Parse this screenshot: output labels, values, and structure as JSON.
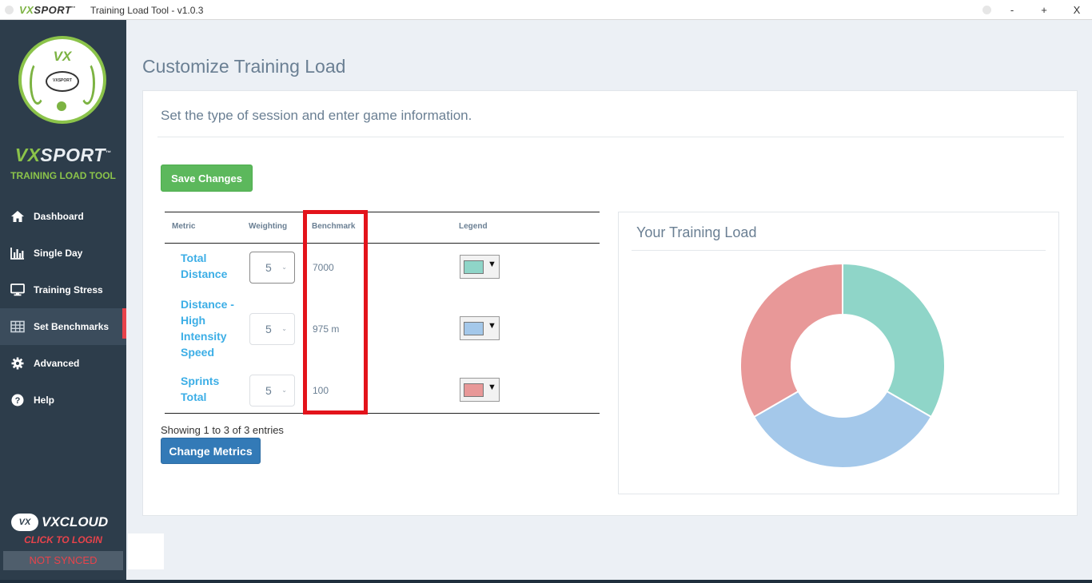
{
  "titlebar": {
    "brand_vx": "VX",
    "brand_sport": "SPORT",
    "brand_tm": "™",
    "app_title": "Training Load Tool - v1.0.3",
    "minimize": "-",
    "maximize": "+",
    "close": "X"
  },
  "sidebar": {
    "logo_vx": "VX",
    "logo_ball_text": "VXSPORT",
    "brand_vx": "VX",
    "brand_sport": "SPORT",
    "brand_tm": "™",
    "tool_name": "TRAINING LOAD TOOL",
    "nav": [
      {
        "label": "Dashboard",
        "icon": "home-icon"
      },
      {
        "label": "Single Day",
        "icon": "bar-chart-icon"
      },
      {
        "label": "Training Stress",
        "icon": "monitor-icon"
      },
      {
        "label": "Set Benchmarks",
        "icon": "table-icon",
        "active": true
      },
      {
        "label": "Advanced",
        "icon": "gear-icon"
      },
      {
        "label": "Help",
        "icon": "help-icon"
      }
    ],
    "cloud": {
      "vx": "VX",
      "word": "VXCLOUD",
      "login": "CLICK TO LOGIN",
      "status": "NOT SYNCED"
    }
  },
  "main": {
    "page_title": "Customize Training Load",
    "subtitle": "Set the type of session and enter game information.",
    "save_button": "Save Changes",
    "table": {
      "headers": {
        "metric": "Metric",
        "weighting": "Weighting",
        "benchmark": "Benchmark",
        "legend": "Legend"
      },
      "rows": [
        {
          "metric": "Total Distance",
          "weighting": "5",
          "benchmark": "7000",
          "legend_color": "#8fd5c8"
        },
        {
          "metric": "Distance - High Intensity Speed",
          "weighting": "5",
          "benchmark": "975 m",
          "legend_color": "#a4c8ea"
        },
        {
          "metric": "Sprints Total",
          "weighting": "5",
          "benchmark": "100",
          "legend_color": "#e89898"
        }
      ]
    },
    "showing": "Showing 1 to 3 of 3 entries",
    "change_metrics_button": "Change Metrics"
  },
  "chart_data": {
    "type": "pie",
    "variant": "donut",
    "title": "Your Training Load",
    "categories": [
      "Total Distance",
      "Distance - High Intensity Speed",
      "Sprints Total"
    ],
    "values": [
      5,
      5,
      5
    ],
    "colors": [
      "#8fd5c8",
      "#a4c8ea",
      "#e89898"
    ]
  }
}
